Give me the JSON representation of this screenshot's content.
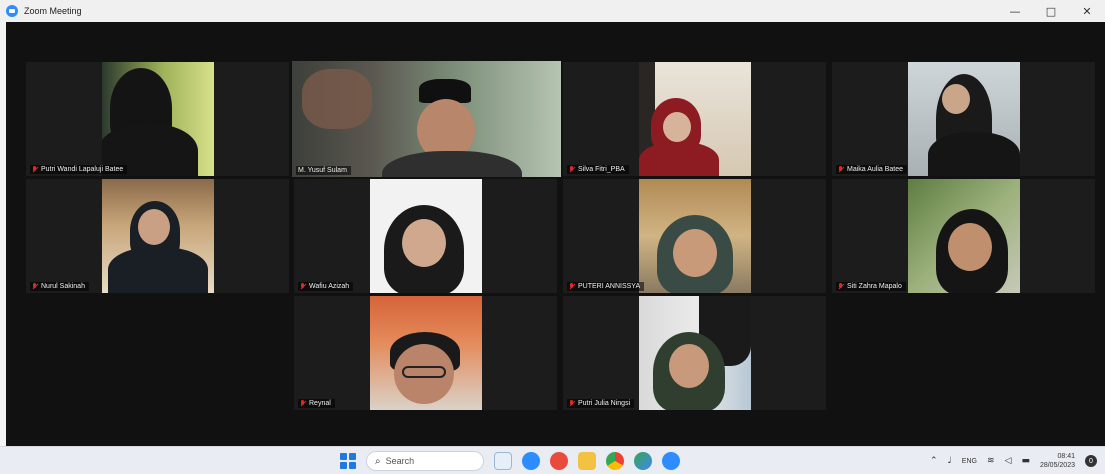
{
  "window": {
    "title": "Zoom Meeting",
    "minimize_icon": "minimize-icon",
    "maximize_icon": "maximize-icon",
    "close_icon": "close-icon",
    "minimize_glyph": "—",
    "maximize_glyph": "□",
    "close_glyph": "✕"
  },
  "participants": [
    {
      "name": "Putri Wandi Lapaluji Batee",
      "muted": true,
      "active": false
    },
    {
      "name": "M. Yusuf Sulam",
      "muted": false,
      "active": true
    },
    {
      "name": "Silva Fitri_PBA",
      "muted": true,
      "active": false
    },
    {
      "name": "Maika Aulia Batee",
      "muted": true,
      "active": false
    },
    {
      "name": "Nurul Sakinah",
      "muted": true,
      "active": false
    },
    {
      "name": "Wafiu Azizah",
      "muted": true,
      "active": false
    },
    {
      "name": "PUTERI ANNISSYA",
      "muted": true,
      "active": false
    },
    {
      "name": "Siti Zahra Mapalo",
      "muted": true,
      "active": false
    },
    {
      "name": "Reynal",
      "muted": true,
      "active": false
    },
    {
      "name": "Putri Julia Ningsi",
      "muted": true,
      "active": false
    }
  ],
  "taskbar": {
    "search_placeholder": "Search",
    "apps": [
      "file-explorer",
      "zoom-video",
      "browser",
      "folder",
      "chrome",
      "photos",
      "zoom"
    ],
    "tray": {
      "language": "ENG",
      "time": "08:41",
      "date": "28/05/2023",
      "notifications": "0"
    }
  },
  "colors": {
    "active_speaker_outline": "#c8d86a",
    "muted_icon": "#e02828",
    "zoom_blue": "#2d8cff"
  }
}
